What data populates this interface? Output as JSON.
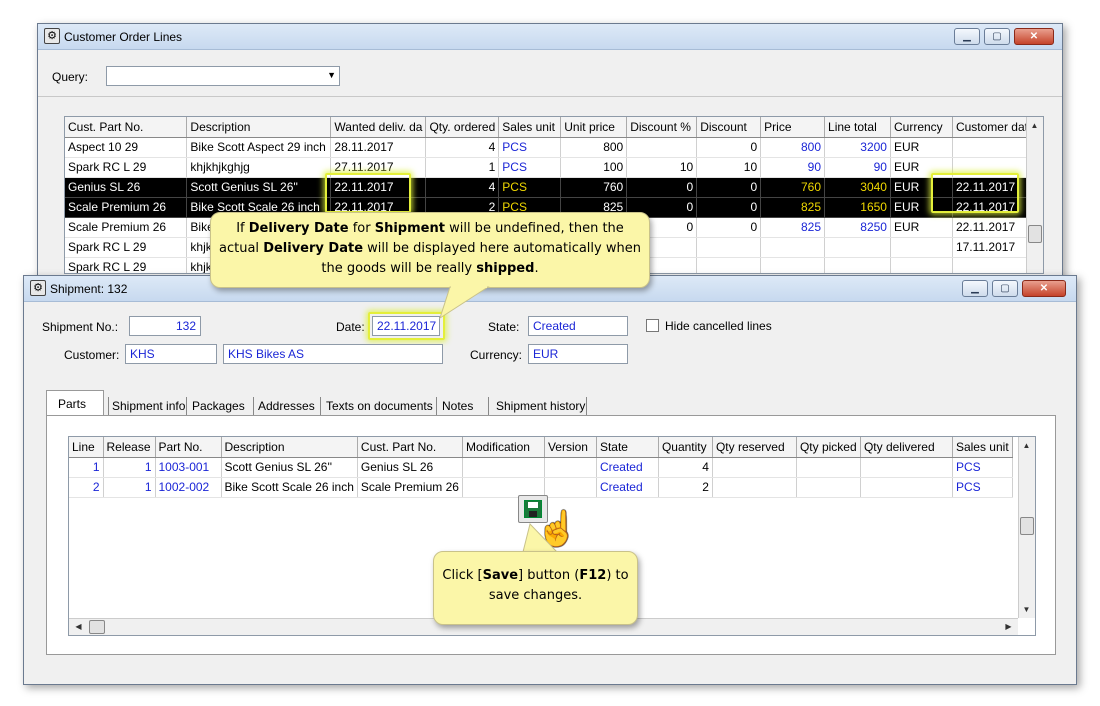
{
  "order_window": {
    "title": "Customer Order Lines",
    "query_label": "Query:",
    "query_value": "",
    "columns": [
      "Cust. Part No.",
      "Description",
      "Wanted deliv. da",
      "Qty. ordered",
      "Sales unit",
      "Unit price",
      "Discount %",
      "Discount",
      "Price",
      "Line total",
      "Currency",
      "Customer date"
    ],
    "rows": [
      {
        "part": "Aspect 10 29",
        "desc": "Bike Scott Aspect 29 inch",
        "wanted": "28.11.2017",
        "qty": "4",
        "unit": "PCS",
        "unit_price": "800",
        "disc_pct": "",
        "disc": "0",
        "price": "800",
        "total": "3200",
        "currency": "EUR",
        "cust_date": ""
      },
      {
        "part": "Spark RC L 29",
        "desc": "khjkhjkghjg",
        "wanted": "27.11.2017",
        "qty": "1",
        "unit": "PCS",
        "unit_price": "100",
        "disc_pct": "10",
        "disc": "10",
        "price": "90",
        "total": "90",
        "currency": "EUR",
        "cust_date": ""
      },
      {
        "part": "Genius SL 26",
        "desc": "Scott Genius SL 26''",
        "wanted": "22.11.2017",
        "qty": "4",
        "unit": "PCS",
        "unit_price": "760",
        "disc_pct": "0",
        "disc": "0",
        "price": "760",
        "total": "3040",
        "currency": "EUR",
        "cust_date": "22.11.2017"
      },
      {
        "part": "Scale Premium 26",
        "desc": "Bike Scott Scale 26 inch",
        "wanted": "22.11.2017",
        "qty": "2",
        "unit": "PCS",
        "unit_price": "825",
        "disc_pct": "0",
        "disc": "0",
        "price": "825",
        "total": "1650",
        "currency": "EUR",
        "cust_date": "22.11.2017"
      },
      {
        "part": "Scale Premium 26",
        "desc": "Bike",
        "wanted": "",
        "qty": "",
        "unit": "",
        "unit_price": "",
        "disc_pct": "0",
        "disc": "0",
        "price": "825",
        "total": "8250",
        "currency": "EUR",
        "cust_date": "22.11.2017"
      },
      {
        "part": "Spark RC L 29",
        "desc": "khjk",
        "wanted": "",
        "qty": "",
        "unit": "",
        "unit_price": "",
        "disc_pct": "",
        "disc": "",
        "price": "",
        "total": "",
        "currency": "",
        "cust_date": "17.11.2017"
      },
      {
        "part": "Spark RC L 29",
        "desc": "khjk",
        "wanted": "",
        "qty": "",
        "unit": "",
        "unit_price": "",
        "disc_pct": "",
        "disc": "",
        "price": "",
        "total": "",
        "currency": "",
        "cust_date": ""
      }
    ]
  },
  "shipment_window": {
    "title": "Shipment: 132",
    "shipment_no_label": "Shipment No.:",
    "shipment_no": "132",
    "date_label": "Date:",
    "date": "22.11.2017",
    "state_label": "State:",
    "state": "Created",
    "hide_cancelled_label": "Hide cancelled lines",
    "customer_label": "Customer:",
    "customer_code": "KHS",
    "customer_name": "KHS Bikes AS",
    "currency_label": "Currency:",
    "currency": "EUR",
    "tabs": [
      "Parts",
      "Shipment info",
      "Packages",
      "Addresses",
      "Texts on documents",
      "Notes",
      "Shipment history"
    ],
    "columns": [
      "Line",
      "Release",
      "Part No.",
      "Description",
      "Cust. Part No.",
      "Modification",
      "Version",
      "State",
      "Quantity",
      "Qty reserved",
      "Qty picked",
      "Qty delivered",
      "Sales unit"
    ],
    "rows": [
      {
        "line": "1",
        "release": "1",
        "part": "1003-001",
        "desc": "Scott Genius SL 26''",
        "cust_part": "Genius SL 26",
        "mod": "",
        "ver": "",
        "state": "Created",
        "qty": "4",
        "reserved": "",
        "picked": "",
        "delivered": "",
        "unit": "PCS"
      },
      {
        "line": "2",
        "release": "1",
        "part": "1002-002",
        "desc": "Bike Scott Scale 26 inch",
        "cust_part": "Scale Premium 26",
        "mod": "",
        "ver": "",
        "state": "Created",
        "qty": "2",
        "reserved": "",
        "picked": "",
        "delivered": "",
        "unit": "PCS"
      }
    ]
  },
  "callout_delivery": {
    "p1": "If ",
    "b1": "Delivery Date",
    "p2": " for ",
    "b2": "Shipment",
    "p3": " will be undefined, then the actual ",
    "b3": "Delivery Date",
    "p4": " will be displayed here automatically when the goods will be really ",
    "b4": "shipped",
    "p5": "."
  },
  "callout_save": {
    "p1": "Click [",
    "b1": "Save",
    "p2": "] button (",
    "b2": "F12",
    "p3": ") to save changes."
  },
  "colors": {
    "accent_blue": "#1a25d6",
    "highlight": "#e4ef3a",
    "callout_bg": "#fbf6a8",
    "selected_text": "#f0d800"
  }
}
